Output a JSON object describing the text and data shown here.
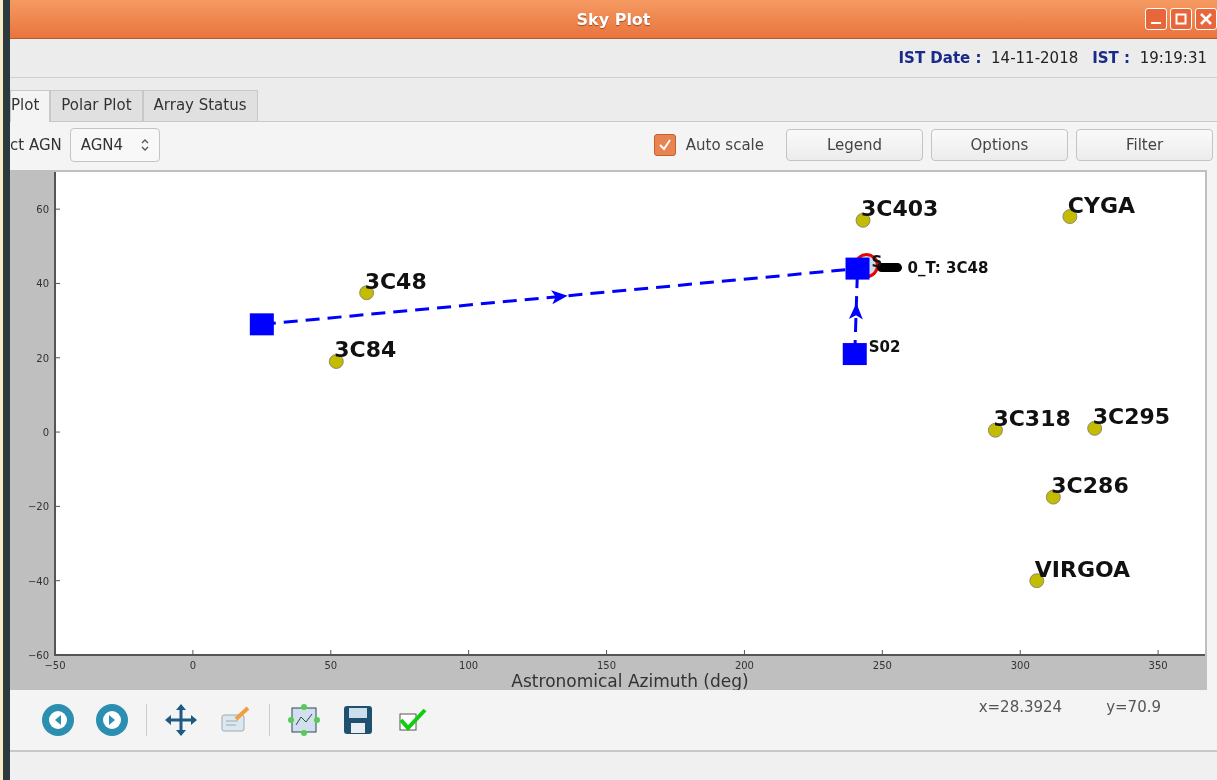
{
  "window": {
    "title": "Sky Plot"
  },
  "clock": {
    "date_label": "IST Date :",
    "date": "14-11-2018",
    "time_label": "IST :",
    "time": "19:19:31"
  },
  "tabs": [
    {
      "label": "Plot",
      "selected": true
    },
    {
      "label": "Polar Plot",
      "selected": false
    },
    {
      "label": "Array Status",
      "selected": false
    }
  ],
  "controls": {
    "select_label": "ct AGN",
    "select_value": "AGN4",
    "auto_scale": {
      "label": "Auto scale",
      "checked": true
    },
    "buttons": [
      "Legend",
      "Options",
      "Filter"
    ]
  },
  "plot": {
    "chart_data": {
      "type": "scatter",
      "xlabel": "Astronomical Azimuth (deg)",
      "xlim": [
        -50,
        367
      ],
      "ylim": [
        -60,
        70
      ],
      "xticks": [
        {
          "value": -50,
          "label": "−50"
        },
        0,
        50,
        100,
        150,
        200,
        250,
        300,
        350
      ],
      "yticks": [
        {
          "value": -60,
          "label": "−60"
        },
        {
          "value": -40,
          "label": "−40"
        },
        {
          "value": -20,
          "label": "−20"
        },
        0,
        20,
        40,
        60
      ],
      "series": [
        {
          "color": "#c4bc00",
          "x": [
            243,
            318,
            63,
            52,
            291,
            327,
            312,
            306
          ],
          "values": [
            57,
            58,
            37.5,
            19,
            0.5,
            1,
            -17.5,
            -40
          ]
        },
        {
          "color": "#0000ff",
          "x": [
            25,
            240,
            241
          ],
          "values": [
            29,
            21,
            44
          ]
        }
      ],
      "annotations": [
        {
          "text": "3C403",
          "x": 243,
          "y": 57
        },
        {
          "text": "CYGA",
          "x": 318,
          "y": 58
        },
        {
          "text": "3C48",
          "x": 63,
          "y": 37.5
        },
        {
          "text": "3C84",
          "x": 52,
          "y": 19
        },
        {
          "text": "3C318",
          "x": 291,
          "y": 0.5
        },
        {
          "text": "3C295",
          "x": 327,
          "y": 1
        },
        {
          "text": "3C286",
          "x": 312,
          "y": -17.5
        },
        {
          "text": "VIRGOA",
          "x": 306,
          "y": -40
        },
        {
          "text": "S02",
          "x": 240,
          "y": 21
        },
        {
          "text": "S",
          "x": 241,
          "y": 44
        },
        "0_T: 3C48"
      ]
    }
  },
  "status": {
    "x": "x=28.3924",
    "y": "y=70.9"
  }
}
